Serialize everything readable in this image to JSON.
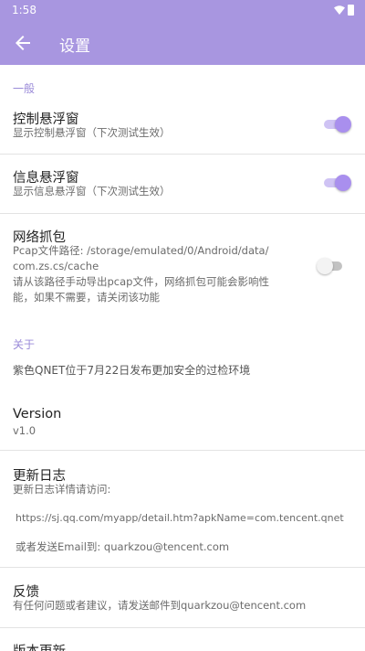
{
  "status": {
    "time": "1:58"
  },
  "appbar": {
    "title": "设置",
    "back_icon": "arrow-back-icon"
  },
  "categories": {
    "general": "一般",
    "about": "关于"
  },
  "float_control": {
    "title": "控制悬浮窗",
    "summary": "显示控制悬浮窗（下次测试生效）",
    "enabled": true
  },
  "float_info": {
    "title": "信息悬浮窗",
    "summary": "显示信息悬浮窗（下次测试生效）",
    "enabled": true
  },
  "capture": {
    "title": "网络抓包",
    "summary_lines": [
      "Pcap文件路径: /storage/emulated/0/Android/data/",
      "com.zs.cs/cache",
      "请从该路径手动导出pcap文件，网络抓包可能会影响性",
      "能，如果不需要，请关闭该功能"
    ],
    "enabled": false
  },
  "about_note": "紫色QNET位于7月22日发布更加安全的过检环境",
  "version": {
    "title": "Version",
    "value": "v1.0"
  },
  "changelog": {
    "title": "更新日志",
    "summary": "更新日志详情请访问:",
    "url": "https://sj.qq.com/myapp/detail.htm?apkName=com.tencent.qnet",
    "email": "或者发送Email到: quarkzou@tencent.com"
  },
  "feedback": {
    "title": "反馈",
    "summary": "有任何问题或者建议，请发送邮件到quarkzou@tencent.com"
  },
  "update": {
    "title": "版本更新"
  },
  "colors": {
    "accent": "#a896e0",
    "switch_on": "#a98fee",
    "category": "#9a8ad8"
  }
}
